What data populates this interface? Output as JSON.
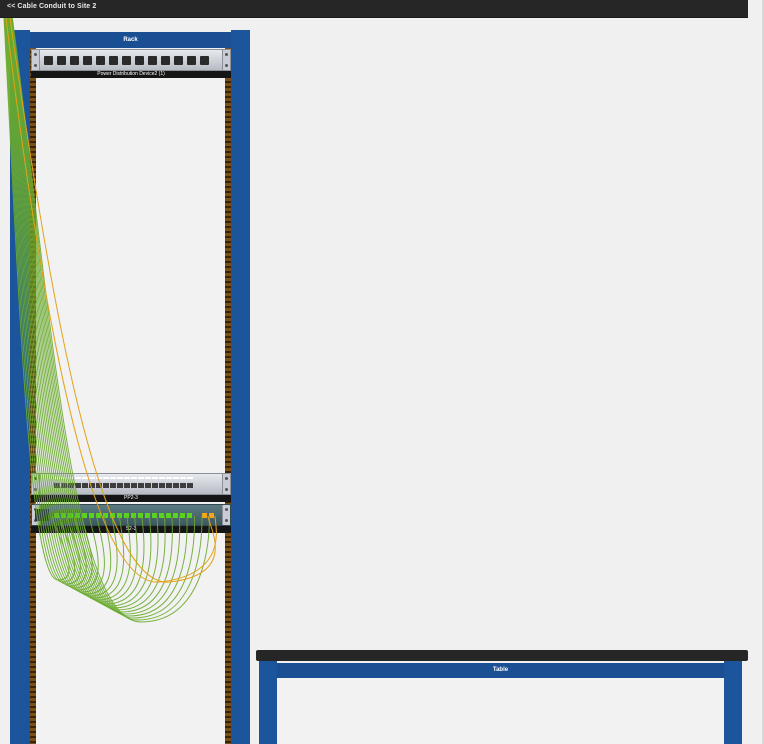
{
  "topbar": {
    "back_link": "<< Cable Conduit to Site 2"
  },
  "rack": {
    "title": "Rack",
    "devices": {
      "pdu": {
        "label": "Power Distribution Device2 (1)"
      },
      "patch_panel": {
        "label": "PP2-3"
      },
      "switch": {
        "label": "S2-3"
      }
    }
  },
  "table": {
    "title": "Table"
  },
  "colors": {
    "rack_blue": "#1d559d",
    "cable_green": "#6aab2e",
    "cable_orange": "#e3a21a",
    "port_green": "#59d31d"
  },
  "icons": [
    "pdu-outlet-icon",
    "rj45-port-icon",
    "switch-logo-icon"
  ]
}
